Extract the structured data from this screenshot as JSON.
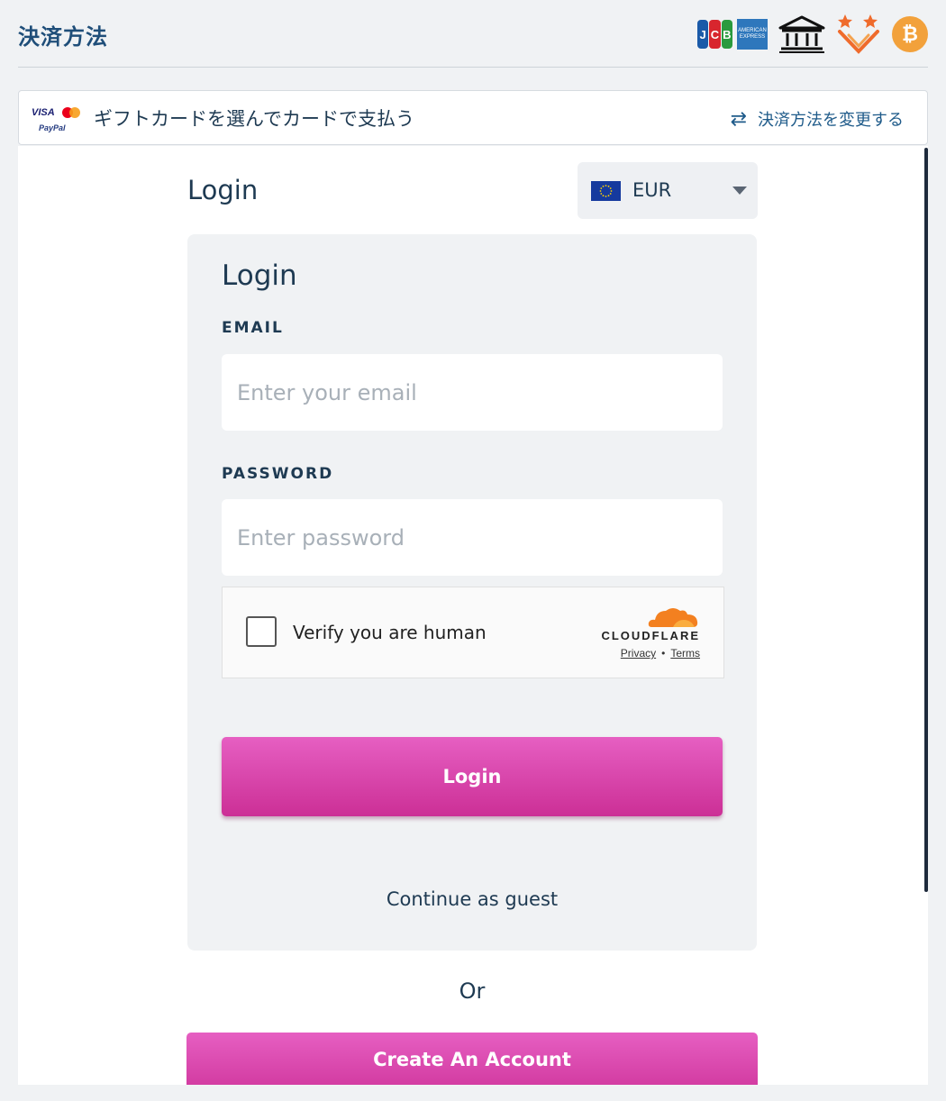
{
  "header": {
    "title": "決済方法",
    "payment_icons": {
      "jcb": [
        "J",
        "C",
        "B"
      ],
      "amex": "AMERICAN EXPRESS",
      "bank": "bank-icon",
      "stars": "stars-icon",
      "bitcoin": "₿"
    }
  },
  "method_bar": {
    "logos": {
      "visa": "VISA",
      "paypal": "PayPal"
    },
    "text": "ギフトカードを選んでカードで支払う",
    "change_label": "決済方法を変更する",
    "change_icon": "⇄"
  },
  "login": {
    "heading": "Login",
    "currency": {
      "code": "EUR"
    },
    "card_title": "Login",
    "email": {
      "label": "EMAIL",
      "placeholder": "Enter your email",
      "value": ""
    },
    "password": {
      "label": "PASSWORD",
      "placeholder": "Enter password",
      "value": ""
    },
    "captcha": {
      "label": "Verify you are human",
      "brand": "CLOUDFLARE",
      "privacy": "Privacy",
      "separator": "•",
      "terms": "Terms"
    },
    "login_button": "Login",
    "guest_link": "Continue as guest"
  },
  "or_text": "Or",
  "create_button": "Create An Account",
  "colors": {
    "accent": "#d93fa5",
    "text": "#1e3a52",
    "header_title": "#1f4e79",
    "cloudflare": "#f38020"
  }
}
